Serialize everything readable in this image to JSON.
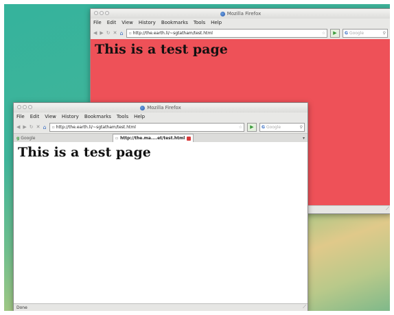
{
  "window_back": {
    "title": "Mozilla Firefox",
    "menu": [
      "File",
      "Edit",
      "View",
      "History",
      "Bookmarks",
      "Tools",
      "Help"
    ],
    "url": "http://the.earth.li/~sgtatham/test.html",
    "search_placeholder": "Google",
    "heading": "This is a test page",
    "content_bg": "#ee5158"
  },
  "window_front": {
    "title": "Mozilla Firefox",
    "menu": [
      "File",
      "Edit",
      "View",
      "History",
      "Bookmarks",
      "Tools",
      "Help"
    ],
    "url": "http://the.earth.li/~sgtatham/test.html",
    "search_placeholder": "Google",
    "tabs": [
      {
        "label": "Google"
      },
      {
        "label": "http://the.ma....et/test.html"
      }
    ],
    "heading": "This is a test page",
    "status": "Done",
    "content_bg": "#ffffff"
  }
}
